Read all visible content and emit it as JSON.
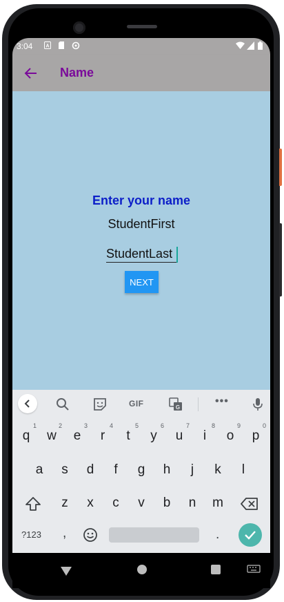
{
  "status_bar": {
    "time": "3:04",
    "icons": [
      "a-notification-icon",
      "sd-card-icon",
      "sync-icon",
      "wifi-icon",
      "signal-icon",
      "battery-icon"
    ]
  },
  "app_bar": {
    "title": "Name",
    "back_icon": "arrow-left-icon",
    "background": "#a8a6a6",
    "title_color": "#7a0a9a"
  },
  "form": {
    "heading": "Enter your name",
    "first_name_value": "StudentFirst",
    "last_name_value": "StudentLast",
    "next_label": "NEXT",
    "background": "#a8cde1",
    "heading_color": "#0c1ec8",
    "button_color": "#2196f3"
  },
  "keyboard": {
    "toolbar": {
      "icons": [
        "chevron-left-icon",
        "search-icon",
        "sticker-icon",
        "gif-icon",
        "translate-icon",
        "more-icon",
        "mic-icon"
      ],
      "gif_label": "GIF",
      "more_label": "•••"
    },
    "row1": [
      {
        "key": "q",
        "hint": "1"
      },
      {
        "key": "w",
        "hint": "2"
      },
      {
        "key": "e",
        "hint": "3"
      },
      {
        "key": "r",
        "hint": "4"
      },
      {
        "key": "t",
        "hint": "5"
      },
      {
        "key": "y",
        "hint": "6"
      },
      {
        "key": "u",
        "hint": "7"
      },
      {
        "key": "i",
        "hint": "8"
      },
      {
        "key": "o",
        "hint": "9"
      },
      {
        "key": "p",
        "hint": "0"
      }
    ],
    "row2": [
      "a",
      "s",
      "d",
      "f",
      "g",
      "h",
      "j",
      "k",
      "l"
    ],
    "row3": [
      "z",
      "x",
      "c",
      "v",
      "b",
      "n",
      "m"
    ],
    "symbols_label": "?123",
    "comma_label": ",",
    "period_label": ".",
    "accent_color": "#4db6ac"
  },
  "nav_bar": {
    "icons": [
      "nav-back-icon",
      "nav-home-icon",
      "nav-recents-icon",
      "keyboard-switch-icon"
    ]
  }
}
